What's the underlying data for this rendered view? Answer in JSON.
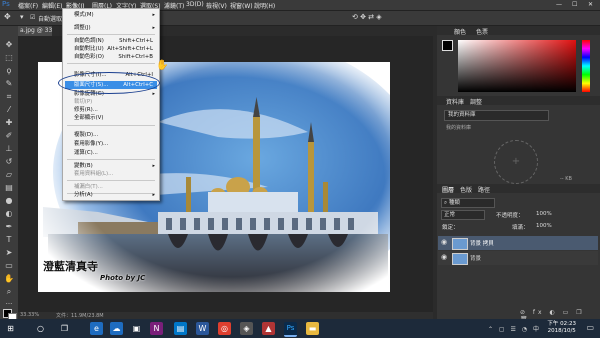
{
  "menubar": {
    "items": [
      "檔案(F)",
      "編輯(E)",
      "影像(I)",
      "圖層(L)",
      "文字(Y)",
      "選取(S)",
      "濾鏡(T)",
      "3D(D)",
      "檢視(V)",
      "視窗(W)",
      "說明(H)"
    ],
    "window_controls": [
      "—",
      "☐",
      "✕"
    ]
  },
  "options_bar": {
    "auto_select": "自動選取："
  },
  "document": {
    "tab_label": "a.jpg @ 33.3% (",
    "zoom": "33.33%",
    "doc_size": "文件：11.9M/23.8M",
    "watermark_title": "澄藍清真寺",
    "watermark_credit": "Photo by JC"
  },
  "image_menu": {
    "items": [
      {
        "label": "模式(M)",
        "shortcut": "",
        "submenu": true,
        "disabled": false,
        "highlighted": false
      },
      {
        "label": "調整(J)",
        "shortcut": "",
        "submenu": true,
        "disabled": false,
        "highlighted": false
      },
      {
        "label": "自動色調(N)",
        "shortcut": "Shift+Ctrl+L",
        "submenu": false,
        "disabled": false,
        "highlighted": false
      },
      {
        "label": "自動對比(U)",
        "shortcut": "Alt+Shift+Ctrl+L",
        "submenu": false,
        "disabled": false,
        "highlighted": false
      },
      {
        "label": "自動色彩(O)",
        "shortcut": "Shift+Ctrl+B",
        "submenu": false,
        "disabled": false,
        "highlighted": false
      },
      {
        "label": "影像尺寸(I)...",
        "shortcut": "Alt+Ctrl+I",
        "submenu": false,
        "disabled": false,
        "highlighted": false
      },
      {
        "label": "版面尺寸(S)...",
        "shortcut": "Alt+Ctrl+C",
        "submenu": false,
        "disabled": false,
        "highlighted": true
      },
      {
        "label": "影像旋轉(G)",
        "shortcut": "",
        "submenu": true,
        "disabled": false,
        "highlighted": false
      },
      {
        "label": "裁切(P)",
        "shortcut": "",
        "submenu": false,
        "disabled": true,
        "highlighted": false
      },
      {
        "label": "修剪(R)...",
        "shortcut": "",
        "submenu": false,
        "disabled": false,
        "highlighted": false
      },
      {
        "label": "全部顯示(V)",
        "shortcut": "",
        "submenu": false,
        "disabled": false,
        "highlighted": false
      },
      {
        "label": "複製(D)...",
        "shortcut": "",
        "submenu": false,
        "disabled": false,
        "highlighted": false
      },
      {
        "label": "套用影像(Y)...",
        "shortcut": "",
        "submenu": false,
        "disabled": false,
        "highlighted": false
      },
      {
        "label": "運算(C)...",
        "shortcut": "",
        "submenu": false,
        "disabled": false,
        "highlighted": false
      },
      {
        "label": "變數(B)",
        "shortcut": "",
        "submenu": true,
        "disabled": false,
        "highlighted": false
      },
      {
        "label": "套用資料組(L)...",
        "shortcut": "",
        "submenu": false,
        "disabled": true,
        "highlighted": false
      },
      {
        "label": "補漏白(T)...",
        "shortcut": "",
        "submenu": false,
        "disabled": true,
        "highlighted": false
      },
      {
        "label": "分析(A)",
        "shortcut": "",
        "submenu": true,
        "disabled": false,
        "highlighted": false
      }
    ]
  },
  "panels": {
    "color_tabs": [
      "顏色",
      "色票"
    ],
    "libraries_tabs": [
      "資料庫",
      "調整"
    ],
    "library_name": "我的資料庫",
    "library_subtext": "我的資料庫",
    "layers_tabs": [
      "圖層",
      "色版",
      "路徑"
    ],
    "kind_filter": "種類",
    "blend_mode": "正常",
    "opacity_label": "不透明度：",
    "opacity_value": "100%",
    "lock_label": "鎖定：",
    "fill_label": "填滿：",
    "fill_value": "100%",
    "layers": [
      {
        "name": "背景 拷貝",
        "selected": true
      },
      {
        "name": "背景",
        "selected": false
      }
    ],
    "kb_label": "-- KB"
  },
  "taskbar": {
    "time": "下午 02:23",
    "date": "2018/10/5"
  },
  "colors": {
    "highlight": "#3a8ee6",
    "annotation_circle": "#1a3f8f",
    "app_dark": "#2b2b2b",
    "panel": "#353535"
  }
}
